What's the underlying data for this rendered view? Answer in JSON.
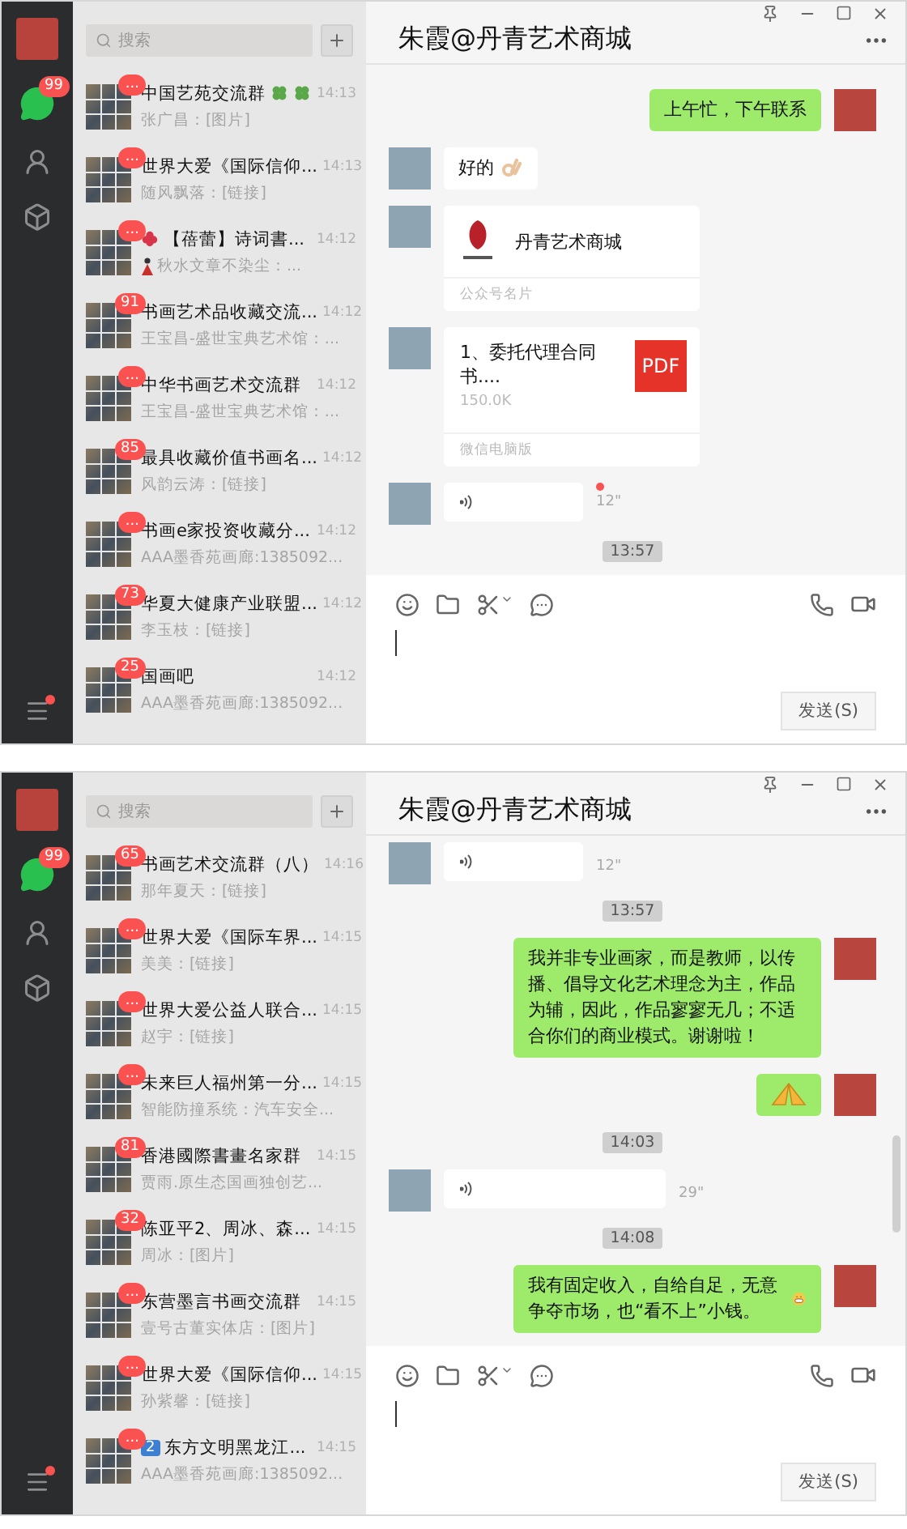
{
  "windows": [
    {
      "sidebar": {
        "unread_badge": "99",
        "menu_alert": true
      },
      "search": {
        "placeholder": "搜索"
      },
      "chats": [
        {
          "name": "中国艺苑交流群",
          "name_icons": [
            {
              "kind": "clover"
            },
            {
              "kind": "clover"
            }
          ],
          "preview": "张广昌：[图片]",
          "time": "14:13",
          "badge": "..."
        },
        {
          "name": "世界大爱《国际信仰...",
          "preview": "随风飘落：[链接]",
          "time": "14:13",
          "badge": "..."
        },
        {
          "name": "【蓓蕾】诗词書...",
          "name_prefix": {
            "kind": "flower"
          },
          "preview_icon": {
            "kind": "figure"
          },
          "preview": "秋水文章不染尘：...",
          "time": "14:12",
          "badge": "..."
        },
        {
          "name": "书画艺术品收藏交流...",
          "preview": "王宝昌-盛世宝典艺术馆：...",
          "time": "14:12",
          "badge": "91"
        },
        {
          "name": "中华书画艺术交流群",
          "preview": "王宝昌-盛世宝典艺术馆：...",
          "time": "14:12",
          "badge": "..."
        },
        {
          "name": "最具收藏价值书画名...",
          "preview": "风韵云涛：[链接]",
          "time": "14:12",
          "badge": "85"
        },
        {
          "name": "书画e家投资收藏分...",
          "preview": "AAA墨香苑画廊:1385092...",
          "time": "14:12",
          "badge": "..."
        },
        {
          "name": "华夏大健康产业联盟...",
          "preview": "李玉枝：[链接]",
          "time": "14:12",
          "badge": "73"
        },
        {
          "name": "国画吧",
          "preview": "AAA墨香苑画廊:1385092...",
          "time": "14:12",
          "badge": "25"
        }
      ],
      "chat": {
        "title": "朱霞@丹青艺术商城",
        "messages": [
          {
            "kind": "text",
            "outgoing": true,
            "text": "上午忙，下午联系"
          },
          {
            "kind": "text",
            "outgoing": false,
            "text": "好的",
            "emoji": {
              "kind": "ok-hand"
            }
          },
          {
            "kind": "card",
            "outgoing": false,
            "title": "丹青艺术商城",
            "footer": "公众号名片"
          },
          {
            "kind": "file",
            "outgoing": false,
            "title": "1、委托代理合同书....",
            "size": "150.0K",
            "icon_label": "PDF",
            "footer": "微信电脑版"
          },
          {
            "kind": "voice",
            "outgoing": false,
            "duration": "12\"",
            "unread": true
          },
          {
            "kind": "time",
            "text": "13:57"
          }
        ]
      },
      "send_button": "发送(S)"
    },
    {
      "sidebar": {
        "unread_badge": "99",
        "menu_alert": true
      },
      "search": {
        "placeholder": "搜索"
      },
      "chats": [
        {
          "name": "书画艺术交流群（八）",
          "preview": "那年夏天：[链接]",
          "time": "14:16",
          "badge": "65"
        },
        {
          "name": "世界大爱《国际车界...",
          "preview": "美美：[链接]",
          "time": "14:15",
          "badge": "..."
        },
        {
          "name": "世界大爱公益人联合...",
          "preview": "赵宇：[链接]",
          "time": "14:15",
          "badge": "..."
        },
        {
          "name": "未来巨人福州第一分...",
          "preview": "智能防撞系统：汽车安全...",
          "time": "14:15",
          "badge": "..."
        },
        {
          "name": "香港國際書畫名家群",
          "preview": "贾雨.原生态国画独创艺...",
          "time": "14:15",
          "badge": "81"
        },
        {
          "name": "陈亚平2、周冰、森...",
          "preview": "周冰：[图片]",
          "time": "14:15",
          "badge": "32"
        },
        {
          "name": "东营墨言书画交流群",
          "preview": "壹号古董实体店：[图片]",
          "time": "14:15",
          "badge": "..."
        },
        {
          "name": "世界大爱《国际信仰...",
          "preview": "孙紫馨：[链接]",
          "time": "14:15",
          "badge": "..."
        },
        {
          "name": "东方文明黑龙江...",
          "name_prefix": {
            "kind": "tag",
            "text": "2"
          },
          "preview": "AAA墨香苑画廊:1385092...",
          "time": "14:15",
          "badge": "..."
        }
      ],
      "chat": {
        "title": "朱霞@丹青艺术商城",
        "messages": [
          {
            "kind": "voice",
            "outgoing": false,
            "duration": "12\""
          },
          {
            "kind": "time",
            "text": "13:57"
          },
          {
            "kind": "text",
            "outgoing": true,
            "text": "我并非专业画家，而是教师，以传播、倡导文化艺术理念为主，作品为辅，因此，作品寥寥无几；不适合你们的商业模式。谢谢啦！"
          },
          {
            "kind": "sticker",
            "outgoing": true
          },
          {
            "kind": "time",
            "text": "14:03"
          },
          {
            "kind": "voice",
            "outgoing": false,
            "duration": "29\""
          },
          {
            "kind": "time",
            "text": "14:08"
          },
          {
            "kind": "text",
            "outgoing": true,
            "text": "我有固定收入，自给自足，无意争夺市场，也“看不上”小钱。",
            "emoji": {
              "kind": "grin"
            }
          }
        ],
        "scrollbar": true
      },
      "send_button": "发送(S)"
    }
  ]
}
